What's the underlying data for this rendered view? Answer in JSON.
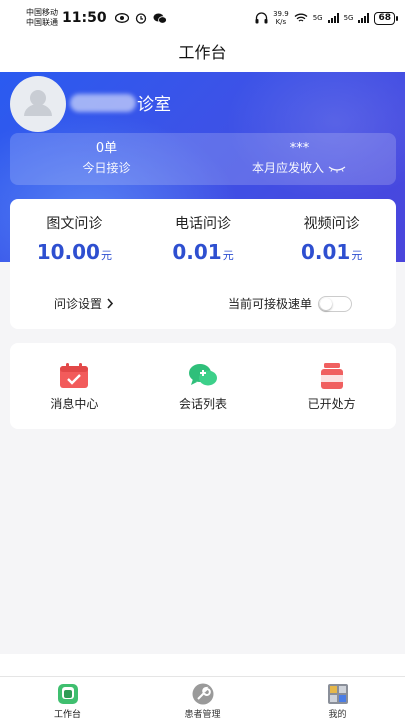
{
  "status_bar": {
    "carrier_1": "中国移动",
    "carrier_2": "中国联通",
    "time": "11:50",
    "speed_value": "39.9",
    "speed_unit": "K/s",
    "net_1": "5G",
    "net_2": "5G",
    "battery": "68"
  },
  "title_bar": {
    "title": "工作台"
  },
  "header": {
    "clinic_suffix": "诊室",
    "stats": [
      {
        "value": "0单",
        "label": "今日接诊"
      },
      {
        "value": "***",
        "label": "本月应发收入"
      }
    ]
  },
  "consult_prices": [
    {
      "name": "图文问诊",
      "amount": "10.00",
      "unit": "元"
    },
    {
      "name": "电话问诊",
      "amount": "0.01",
      "unit": "元"
    },
    {
      "name": "视频问诊",
      "amount": "0.01",
      "unit": "元"
    }
  ],
  "settings": {
    "link_label": "问诊设置",
    "express_label": "当前可接极速单"
  },
  "actions": [
    {
      "label": "消息中心",
      "icon": "calendar-check-icon",
      "color": "#f25b5b"
    },
    {
      "label": "会话列表",
      "icon": "chat-bubbles-icon",
      "color": "#2fbf7a"
    },
    {
      "label": "已开处方",
      "icon": "prescription-bottle-icon",
      "color": "#f06060"
    }
  ],
  "tabbar": [
    {
      "label": "工作台",
      "icon": "workbench-icon",
      "active": true
    },
    {
      "label": "患者管理",
      "icon": "wrench-icon",
      "active": false
    },
    {
      "label": "我的",
      "icon": "profile-grid-icon",
      "active": false
    }
  ],
  "colors": {
    "accent": "#2e4fd0",
    "header": "#3b53e8"
  }
}
